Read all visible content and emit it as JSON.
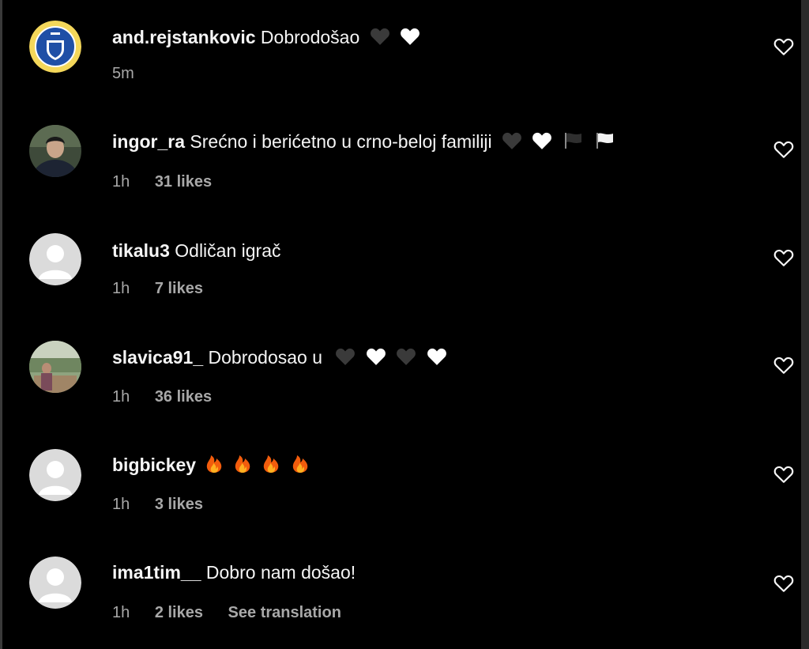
{
  "comments": [
    {
      "username": "and.rejstankovic",
      "text": "Dobrodošao",
      "emoji": [
        "black-heart-icon",
        "white-heart-icon"
      ],
      "time": "5m",
      "likes": "",
      "translate": "",
      "avatar": "club-crest-icon"
    },
    {
      "username": "ingor_ra",
      "text": "Srećno i berićetno u crno-beloj familiji",
      "emoji": [
        "black-heart-icon",
        "white-heart-icon",
        "black-flag-icon",
        "white-flag-icon"
      ],
      "time": "1h",
      "likes": "31 likes",
      "translate": "",
      "avatar": "photo-avatar"
    },
    {
      "username": "tikalu3",
      "text": "Odličan igrač",
      "emoji": [],
      "time": "1h",
      "likes": "7 likes",
      "translate": "",
      "avatar": "default-avatar"
    },
    {
      "username": "slavica91_",
      "text": "Dobrodosao u",
      "emoji": [
        "black-heart-icon",
        "white-heart-icon",
        "black-heart-icon",
        "white-heart-icon"
      ],
      "time": "1h",
      "likes": "36 likes",
      "translate": "",
      "avatar": "photo-avatar"
    },
    {
      "username": "bigbickey",
      "text": "",
      "emoji": [
        "fire-icon",
        "fire-icon",
        "fire-icon",
        "fire-icon"
      ],
      "time": "1h",
      "likes": "3 likes",
      "translate": "",
      "avatar": "default-avatar"
    },
    {
      "username": "ima1tim__",
      "text": "Dobro nam došao!",
      "emoji": [],
      "time": "1h",
      "likes": "2 likes",
      "translate": "See translation",
      "avatar": "default-avatar"
    }
  ],
  "colors": {
    "background": "#000000",
    "primary_text": "#f5f5f5",
    "secondary_text": "#a8a8a8",
    "default_avatar": "#dbdbdb"
  }
}
